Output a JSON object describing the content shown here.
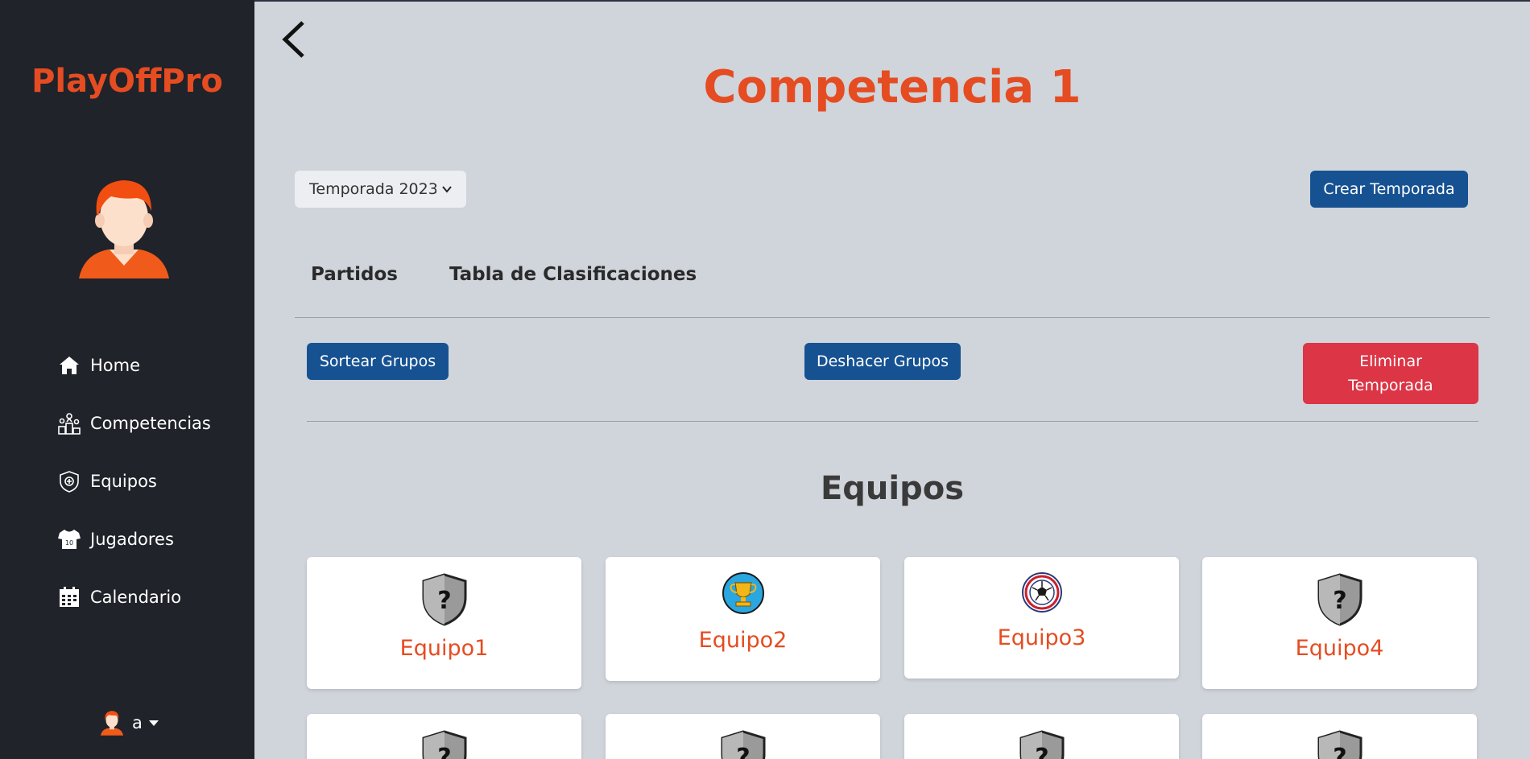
{
  "brand": "PlayOffPro",
  "nav": [
    {
      "label": "Home",
      "icon": "home-icon"
    },
    {
      "label": "Competencias",
      "icon": "trophy-podium-icon"
    },
    {
      "label": "Equipos",
      "icon": "team-shield-icon"
    },
    {
      "label": "Jugadores",
      "icon": "jersey-icon"
    },
    {
      "label": "Calendario",
      "icon": "calendar-icon"
    }
  ],
  "user": {
    "name": "a"
  },
  "page": {
    "title": "Competencia 1"
  },
  "season": {
    "selected": "Temporada 2023"
  },
  "buttons": {
    "create_season": "Crear Temporada",
    "draw_groups": "Sortear Grupos",
    "undo_groups": "Deshacer Grupos",
    "delete_season": "Eliminar Temporada"
  },
  "tabs": [
    "Partidos",
    "Tabla de Clasificaciones"
  ],
  "teams_section": {
    "title": "Equipos"
  },
  "teams": [
    {
      "name": "Equipo1",
      "icon": "unknown-shield-icon"
    },
    {
      "name": "Equipo2",
      "icon": "trophy-icon"
    },
    {
      "name": "Equipo3",
      "icon": "soccer-ball-icon"
    },
    {
      "name": "Equipo4",
      "icon": "unknown-shield-icon"
    }
  ],
  "colors": {
    "accent": "#e54c21",
    "sidebar": "#20232a",
    "primary_button": "#165292",
    "danger_button": "#dc3545",
    "background": "#d0d4db"
  }
}
